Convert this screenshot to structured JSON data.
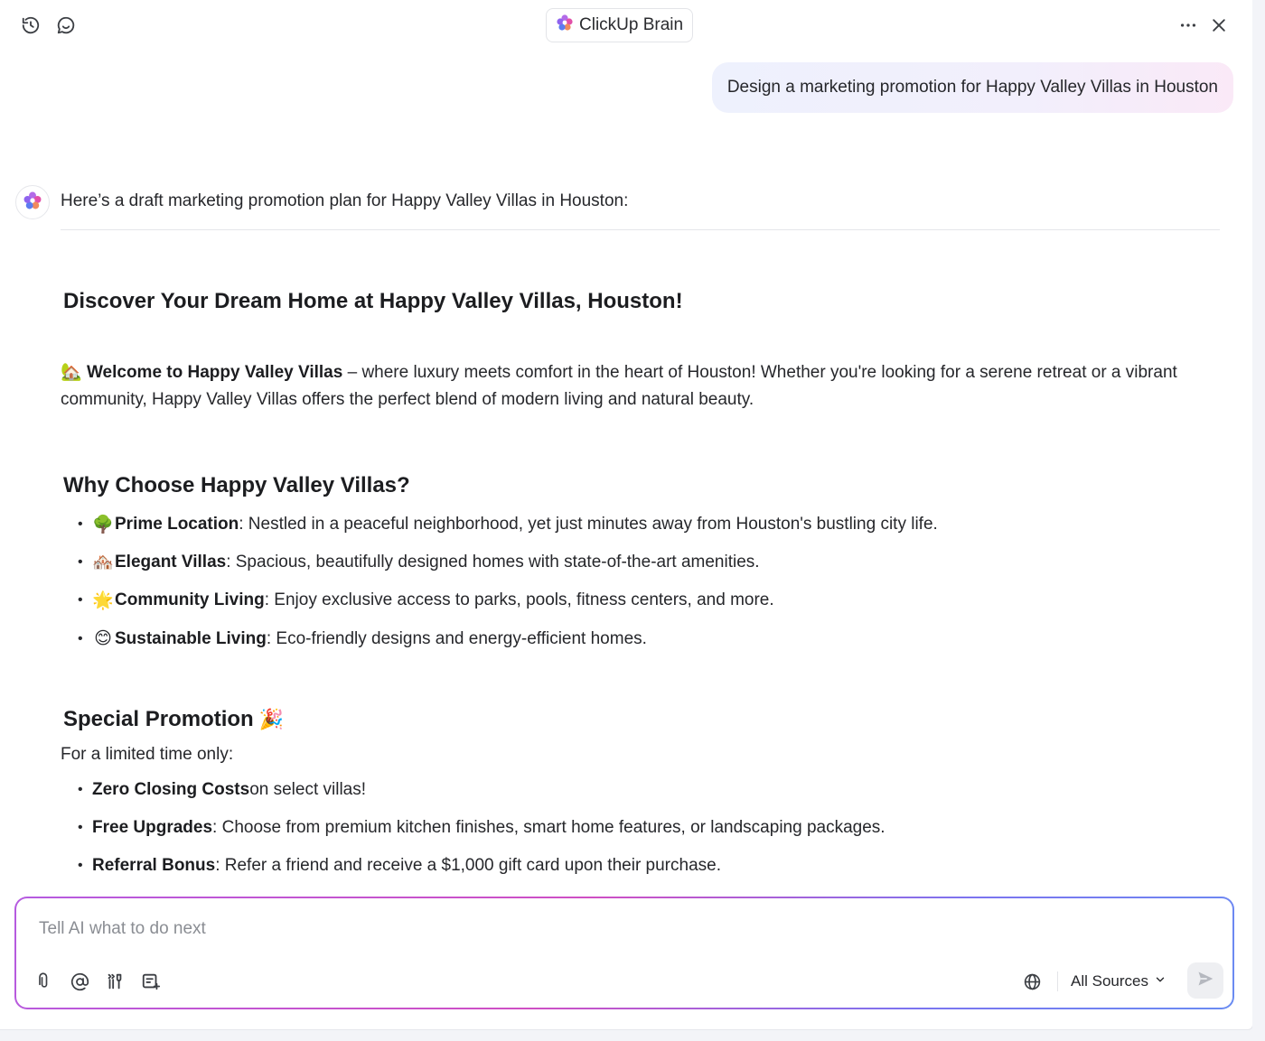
{
  "header": {
    "title": "ClickUp Brain",
    "icons": [
      "history-icon",
      "new-chat-icon",
      "more-icon",
      "close-icon"
    ]
  },
  "user_message": "Design a marketing promotion for Happy Valley Villas in Houston",
  "ai_response": {
    "intro": "Here’s a draft marketing promotion plan for Happy Valley Villas in Houston:",
    "headline": "Discover Your Dream Home at Happy Valley Villas, Houston!",
    "welcome": {
      "emoji": "🏡",
      "bold": "Welcome to Happy Valley Villas",
      "text": " – where luxury meets comfort in the heart of Houston! Whether you're looking for a serene retreat or a vibrant community, Happy Valley Villas offers the perfect blend of modern living and natural beauty."
    },
    "why_heading": "Why Choose Happy Valley Villas?",
    "why_items": [
      {
        "emoji": "🌳",
        "bold": "Prime Location",
        "text": ": Nestled in a peaceful neighborhood, yet just minutes away from Houston's bustling city life."
      },
      {
        "emoji": "🏘️",
        "bold": "Elegant Villas",
        "text": ": Spacious, beautifully designed homes with state-of-the-art amenities."
      },
      {
        "emoji": "🌟",
        "bold": "Community Living",
        "text": ": Enjoy exclusive access to parks, pools, fitness centers, and more."
      },
      {
        "emoji": "😊",
        "bold": "Sustainable Living",
        "text": ": Eco-friendly designs and energy-efficient homes."
      }
    ],
    "promo_heading": "Special Promotion",
    "promo_emoji": "🎉",
    "promo_intro": "For a limited time only:",
    "promo_items": [
      {
        "bold": "Zero Closing Costs",
        "text": " on select villas!"
      },
      {
        "bold": "Free Upgrades",
        "text": ": Choose from premium kitchen finishes, smart home features, or landscaping packages."
      },
      {
        "bold": "Referral Bonus",
        "text": ": Refer a friend and receive a $1,000 gift card upon their purchase."
      }
    ]
  },
  "composer": {
    "placeholder": "Tell AI what to do next",
    "sources_label": "All Sources",
    "tools": [
      "attach-icon",
      "mention-icon",
      "brain-tools-icon",
      "template-icon"
    ]
  },
  "colors": {
    "accent_gradient": [
      "#b55be0",
      "#cf4fc4",
      "#7b74f0",
      "#6a8cf2"
    ],
    "user_bubble": [
      "#eef1fd",
      "#fae9f7"
    ]
  }
}
